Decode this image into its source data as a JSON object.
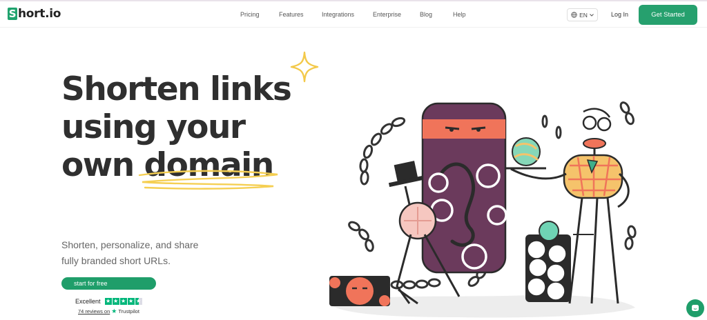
{
  "header": {
    "logo_letter": "S",
    "logo_text": "hort.io",
    "nav": [
      {
        "label": "Pricing"
      },
      {
        "label": "Features"
      },
      {
        "label": "Integrations"
      },
      {
        "label": "Enterprise"
      },
      {
        "label": "Blog"
      },
      {
        "label": "Help"
      }
    ],
    "language": "EN",
    "login": "Log In",
    "cta": "Get Started"
  },
  "hero": {
    "headline": [
      "Shorten links",
      "using your",
      "own domain"
    ],
    "subtext_lines": [
      "Shorten, personalize, and share",
      "fully branded short URLs."
    ],
    "start_button": "start for free"
  },
  "trustpilot": {
    "rating_word": "Excellent",
    "rating_stars": 4.5,
    "reviews_link": "74 reviews on",
    "brand": "Trustpilot"
  },
  "colors": {
    "brand_green": "#26a06e",
    "headline": "#2f2f2f",
    "accent_yellow": "#f5cf52",
    "illustration_purple": "#6b3a5c",
    "illustration_orange": "#f0745a"
  },
  "icons": {
    "globe": "globe-icon",
    "chevron": "chevron-down-icon",
    "chat": "chat-icon",
    "sparkle": "sparkle-icon"
  }
}
